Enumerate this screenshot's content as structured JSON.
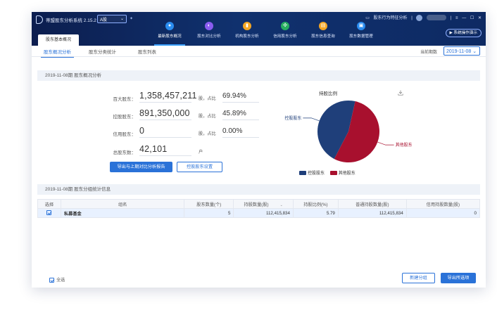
{
  "app": {
    "title": "蒂盟股东分析系统 2.15.2",
    "market_select": "A股",
    "top_right_link": "股东行为特征分析",
    "window_controls": {
      "menu": "≡",
      "minimize": "—",
      "maximize": "☐",
      "close": "✕"
    },
    "demo_button": "系统操作演示",
    "left_tab": "股东基本概况"
  },
  "nav": [
    {
      "label": "最新股东概况",
      "icon": "user-icon",
      "color": "#2a8cf0",
      "glyph": "●"
    },
    {
      "label": "股东对比分析",
      "icon": "pie-icon",
      "color": "#8a5cf0",
      "glyph": "◐"
    },
    {
      "label": "机构股东分析",
      "icon": "bar-chart-icon",
      "color": "#f5a623",
      "glyph": "▮"
    },
    {
      "label": "信用股东分析",
      "icon": "network-icon",
      "color": "#27ae60",
      "glyph": "✣"
    },
    {
      "label": "股东信息查询",
      "icon": "document-icon",
      "color": "#f5a623",
      "glyph": "▤"
    },
    {
      "label": "股东数据管理",
      "icon": "database-icon",
      "color": "#2a8cf0",
      "glyph": "▣"
    }
  ],
  "subtabs": [
    "股东概况分析",
    "股东分类统计",
    "股东列表"
  ],
  "period": {
    "label": "当前期数",
    "value": "2019-11-08"
  },
  "overview": {
    "header": "2019-11-08期 股东概况分析",
    "stats": [
      {
        "label": "百大股东：",
        "value": "1,358,457,211",
        "unit": "股，占比",
        "pct": "69.94%"
      },
      {
        "label": "控股股东：",
        "value": "891,350,000",
        "unit": "股，占比",
        "pct": "45.89%"
      },
      {
        "label": "信用股东：",
        "value": "0",
        "unit": "股，占比",
        "pct": "0.00%"
      },
      {
        "label": "总股东数：",
        "value": "42,101",
        "unit": "户",
        "pct": ""
      }
    ],
    "export_button": "导出与上期对比分析报告",
    "setting_button": "控股股东设置"
  },
  "chart_data": {
    "type": "pie",
    "title": "持股比例",
    "labels": [
      "控股股东",
      "其他股东"
    ],
    "values": [
      45.89,
      54.11
    ],
    "colors": [
      "#1f3f7a",
      "#a8102e"
    ],
    "legend": "bottom"
  },
  "group": {
    "header": "2019-11-08期 股东分组统计信息",
    "columns": [
      "选择",
      "组名",
      "股东数量(个)",
      "持股数量(股)",
      "持股比例(%)",
      "普通持股数量(股)",
      "信用持股数量(股)"
    ],
    "rows": [
      {
        "name": "私募基金",
        "count": "5",
        "shares": "112,415,834",
        "pct": "5.79",
        "normal": "112,415,834",
        "credit": "0",
        "checked": true
      }
    ],
    "select_all": "全选",
    "new_group_button": "新建分组",
    "export_selected_button": "导出所选项"
  }
}
